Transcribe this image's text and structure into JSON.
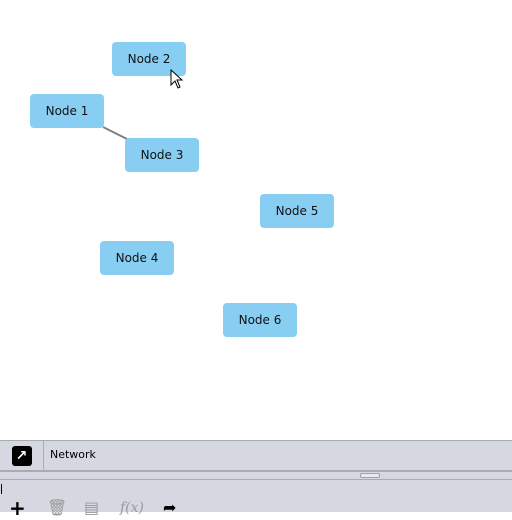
{
  "graph": {
    "nodes": [
      {
        "id": "n2",
        "label": "Node 2"
      },
      {
        "id": "n1",
        "label": "Node 1"
      },
      {
        "id": "n3",
        "label": "Node 3"
      },
      {
        "id": "n5",
        "label": "Node 5"
      },
      {
        "id": "n4",
        "label": "Node 4"
      },
      {
        "id": "n6",
        "label": "Node 6"
      }
    ],
    "edges": [
      {
        "from": "Node 1",
        "to": "Node 3"
      }
    ],
    "node_color": "#87cef2",
    "edge_color": "#808080"
  },
  "tab_bar": {
    "label": "Network",
    "icon": "arrow-up-right-icon"
  },
  "toolbar": {
    "icons": [
      "plus-icon",
      "trash-icon",
      "table-icon",
      "function-icon",
      "share-icon"
    ],
    "function_label": "f(x)"
  }
}
